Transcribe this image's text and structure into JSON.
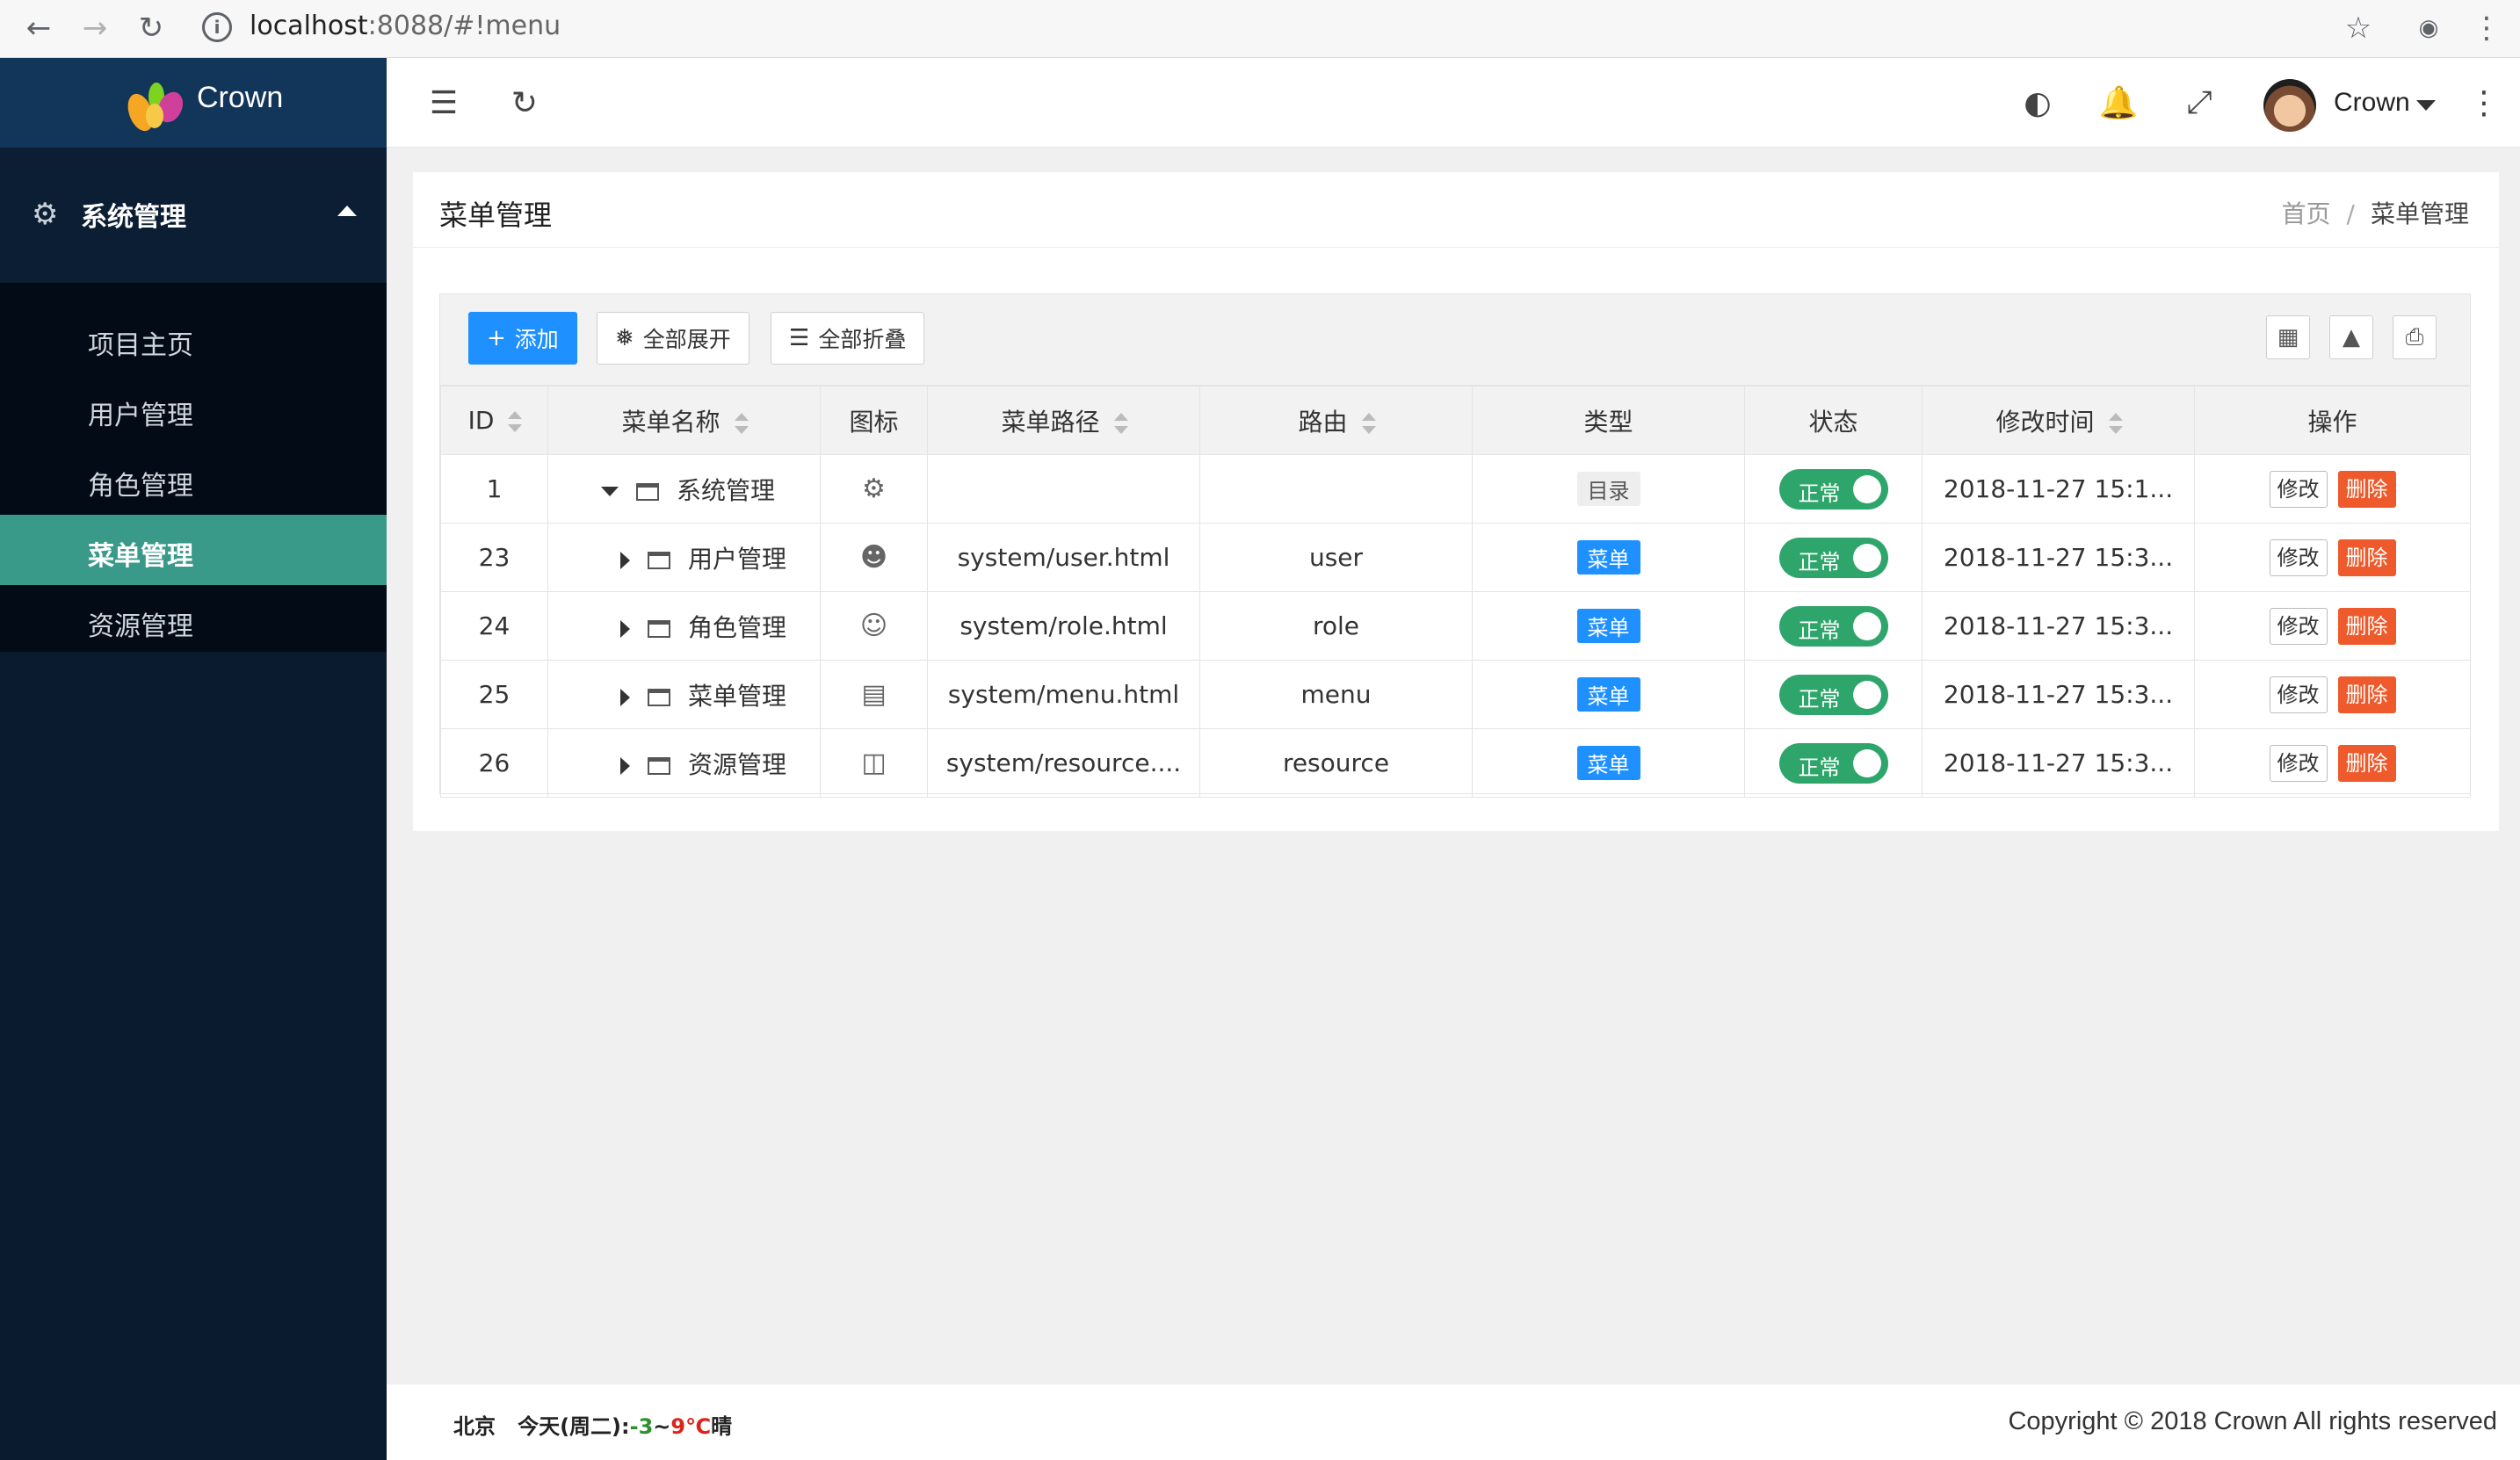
{
  "browser": {
    "url_host": "localhost",
    "url_rest": ":8088/#!menu",
    "back_icon": "back-arrow-icon",
    "forward_icon": "forward-arrow-icon",
    "reload_icon": "reload-icon"
  },
  "brand": {
    "name": "Crown"
  },
  "sidebar": {
    "group_label": "系统管理",
    "items": [
      {
        "label": "项目主页",
        "active": false
      },
      {
        "label": "用户管理",
        "active": false
      },
      {
        "label": "角色管理",
        "active": false
      },
      {
        "label": "菜单管理",
        "active": true
      },
      {
        "label": "资源管理",
        "active": false
      }
    ]
  },
  "header": {
    "user_name": "Crown"
  },
  "page": {
    "title": "菜单管理",
    "breadcrumb": {
      "home": "首页",
      "sep": "/",
      "current": "菜单管理"
    }
  },
  "toolbar": {
    "add_label": "添加",
    "expand_label": "全部展开",
    "collapse_label": "全部折叠"
  },
  "table": {
    "headers": [
      "ID",
      "菜单名称",
      "图标",
      "菜单路径",
      "路由",
      "类型",
      "状态",
      "修改时间",
      "操作"
    ],
    "rows": [
      {
        "id": "1",
        "name": "系统管理",
        "expanded": true,
        "icon": "gear-icon",
        "path": "",
        "route": "",
        "type": "目录",
        "status": "正常",
        "time": "2018-11-27 15:1...",
        "edit": "修改",
        "del": "删除"
      },
      {
        "id": "23",
        "name": "用户管理",
        "expanded": false,
        "icon": "user-icon",
        "path": "system/user.html",
        "route": "user",
        "type": "菜单",
        "status": "正常",
        "time": "2018-11-27 15:3...",
        "edit": "修改",
        "del": "删除"
      },
      {
        "id": "24",
        "name": "角色管理",
        "expanded": false,
        "icon": "face-icon",
        "path": "system/role.html",
        "route": "role",
        "type": "菜单",
        "status": "正常",
        "time": "2018-11-27 15:3...",
        "edit": "修改",
        "del": "删除"
      },
      {
        "id": "25",
        "name": "菜单管理",
        "expanded": false,
        "icon": "menu-doc-icon",
        "path": "system/menu.html",
        "route": "menu",
        "type": "菜单",
        "status": "正常",
        "time": "2018-11-27 15:3...",
        "edit": "修改",
        "del": "删除"
      },
      {
        "id": "26",
        "name": "资源管理",
        "expanded": false,
        "icon": "book-icon",
        "path": "system/resource....",
        "route": "resource",
        "type": "菜单",
        "status": "正常",
        "time": "2018-11-27 15:3...",
        "edit": "修改",
        "del": "删除"
      }
    ]
  },
  "footer": {
    "city": "北京",
    "day": "今天(周二):",
    "temp_low": "-3",
    "temp_sep": "~",
    "temp_high": "9℃",
    "condition": "晴",
    "copyright": "Copyright © 2018 Crown All rights reserved"
  },
  "colors": {
    "sidebar_bg": "#0a1a2f",
    "logo_bg": "#12365a",
    "active_item": "#3a9a8a",
    "primary": "#1e90ff",
    "switch_on": "#2ea56a",
    "danger": "#ee5a2b"
  }
}
